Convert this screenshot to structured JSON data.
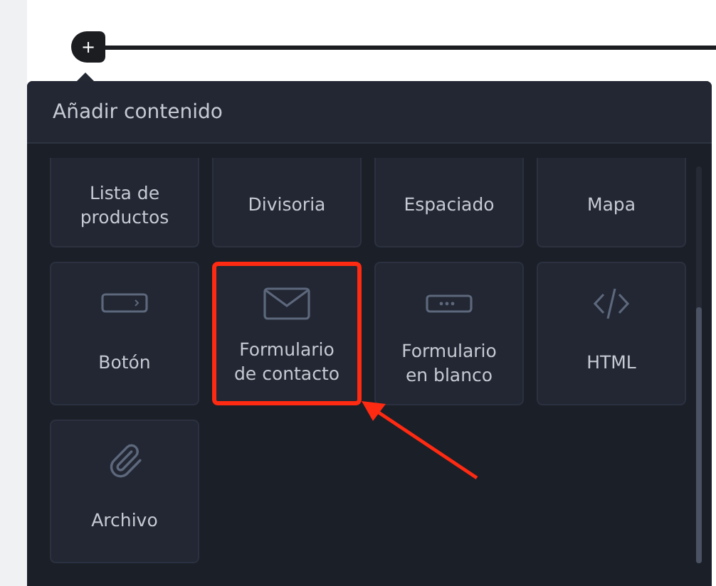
{
  "insert_button": {
    "label": "+"
  },
  "panel": {
    "title": "Añadir contenido",
    "items": [
      {
        "kind": "product-list",
        "label": "Lista de productos",
        "highlighted": false
      },
      {
        "kind": "divider",
        "label": "Divisoria",
        "highlighted": false
      },
      {
        "kind": "spacer",
        "label": "Espaciado",
        "highlighted": false
      },
      {
        "kind": "map",
        "label": "Mapa",
        "highlighted": false
      },
      {
        "kind": "button",
        "label": "Botón",
        "highlighted": false
      },
      {
        "kind": "contact-form",
        "label": "Formulario de contacto",
        "highlighted": true
      },
      {
        "kind": "blank-form",
        "label": "Formulario en blanco",
        "highlighted": false
      },
      {
        "kind": "html",
        "label": "HTML",
        "highlighted": false
      },
      {
        "kind": "file",
        "label": "Archivo",
        "highlighted": false
      }
    ]
  }
}
